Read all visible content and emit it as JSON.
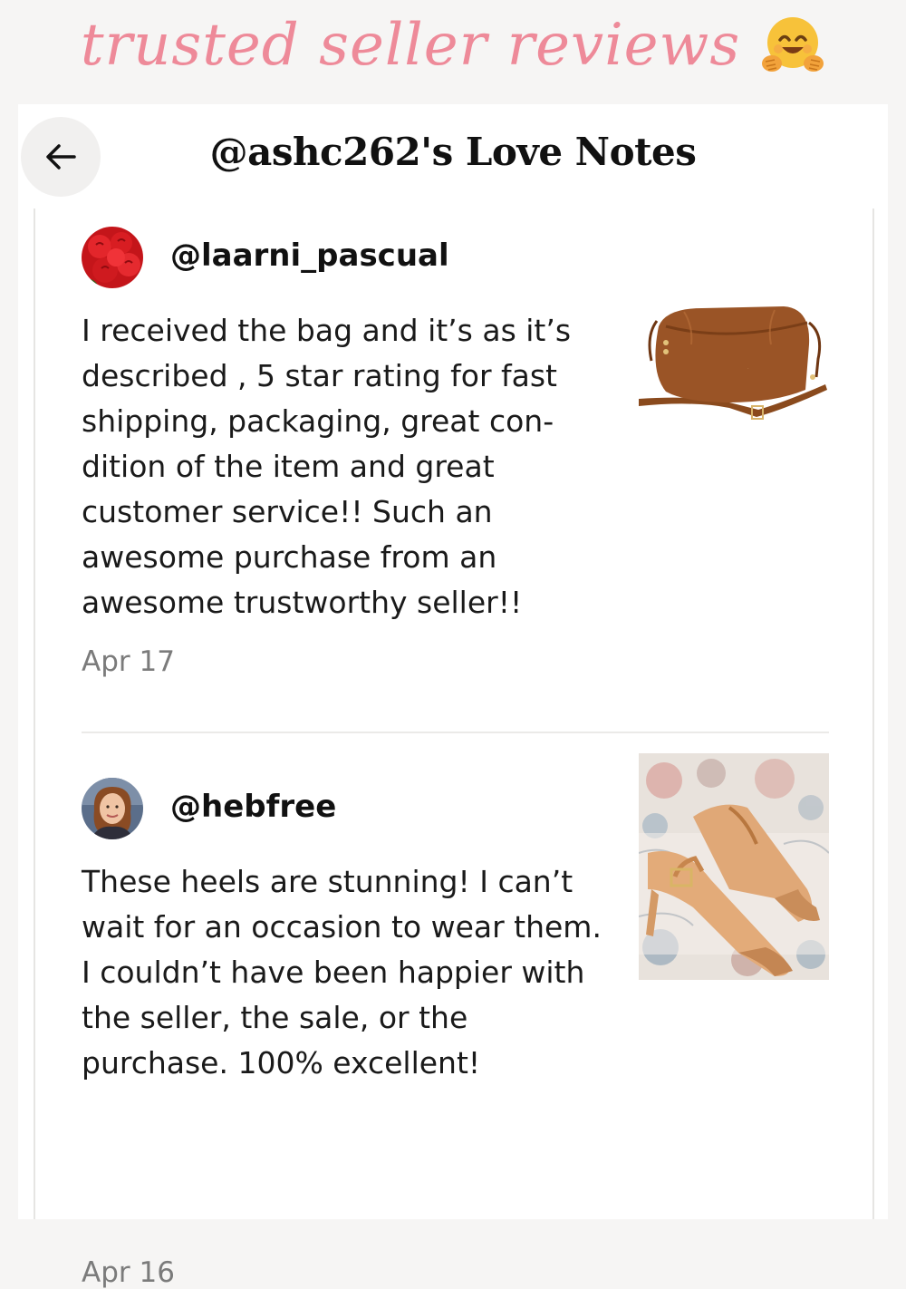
{
  "banner": {
    "text": "trusted seller reviews",
    "emoji": "hugging-face-emoji"
  },
  "header": {
    "title": "@ashc262's Love Notes",
    "back_icon": "arrow-left-icon"
  },
  "reviews": [
    {
      "username": "@laarni_pascual",
      "avatar": "red-roses-avatar",
      "text": "I received the bag and it’s as it’s described , 5 star rating for fast shipping, packaging, great con-dition of the item and great customer service!! Such an awesome purchase from an awesome trustworthy seller!!",
      "date": "Apr 17",
      "product_image": "brown-leather-drawstring-bag"
    },
    {
      "username": "@hebfree",
      "avatar": "woman-portrait-avatar",
      "text": "These heels are stunning! I can’t wait for an occasion to wear them. I couldn’t have been happier with the seller, the sale, or the purchase. 100% excellent!",
      "date": "Apr 16",
      "product_image": "tan-slingback-heels"
    }
  ],
  "colors": {
    "banner_pink": "#ee8a99",
    "background": "#f6f5f4",
    "card": "#ffffff",
    "date_gray": "#7b7b7b"
  }
}
